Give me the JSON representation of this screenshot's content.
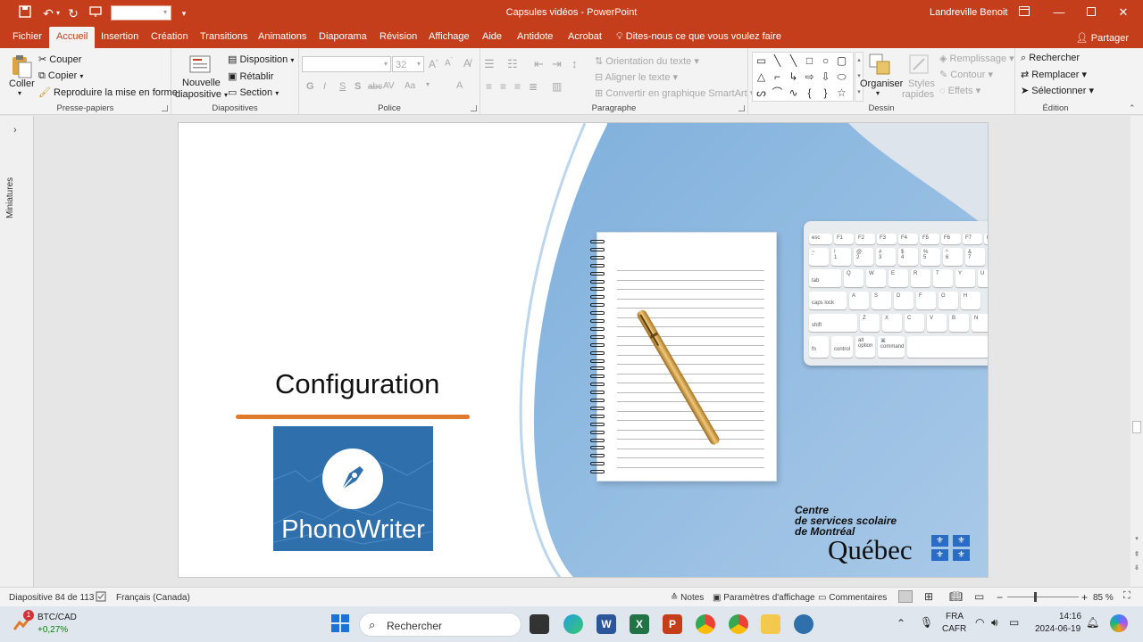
{
  "titlebar": {
    "document_title": "Capsules vidéos - PowerPoint",
    "user_name": "Landreville Benoit"
  },
  "tabs": [
    {
      "label": "Fichier",
      "active": false
    },
    {
      "label": "Accueil",
      "active": true
    },
    {
      "label": "Insertion",
      "active": false
    },
    {
      "label": "Création",
      "active": false
    },
    {
      "label": "Transitions",
      "active": false
    },
    {
      "label": "Animations",
      "active": false
    },
    {
      "label": "Diaporama",
      "active": false
    },
    {
      "label": "Révision",
      "active": false
    },
    {
      "label": "Affichage",
      "active": false
    },
    {
      "label": "Aide",
      "active": false
    },
    {
      "label": "Antidote",
      "active": false
    },
    {
      "label": "Acrobat",
      "active": false
    }
  ],
  "tell_me": "Dites-nous ce que vous voulez faire",
  "share_label": "Partager",
  "ribbon": {
    "clipboard": {
      "label": "Presse-papiers",
      "paste": "Coller",
      "cut": "Couper",
      "copy": "Copier",
      "format_painter": "Reproduire la mise en forme"
    },
    "slides": {
      "label": "Diapositives",
      "new_slide_1": "Nouvelle",
      "new_slide_2": "diapositive",
      "layout": "Disposition",
      "reset": "Rétablir",
      "section": "Section"
    },
    "font": {
      "label": "Police",
      "font_size": "32",
      "bold": "G",
      "italic": "I",
      "underline": "S",
      "shadow": "S",
      "strike": "abc",
      "spacing": "AV",
      "case": "Aa",
      "color": "A"
    },
    "paragraph": {
      "label": "Paragraphe",
      "text_direction": "Orientation du texte",
      "align_text": "Aligner le texte",
      "smartart": "Convertir en graphique SmartArt"
    },
    "drawing": {
      "label": "Dessin",
      "arrange": "Organiser",
      "styles_1": "Styles",
      "styles_2": "rapides",
      "fill": "Remplissage",
      "outline": "Contour",
      "effects": "Effets"
    },
    "editing": {
      "label": "Édition",
      "find": "Rechercher",
      "replace": "Remplacer",
      "select": "Sélectionner"
    }
  },
  "side_panel": {
    "label": "Miniatures"
  },
  "slide": {
    "title": "Configuration",
    "logo_text": "PhonoWriter",
    "brand_line1": "Centre",
    "brand_line2": "de services scolaire",
    "brand_line3": "de Montréal",
    "quebec": "Québec",
    "accent_color": "#e07a2c",
    "logo_color": "#2f6fab",
    "background_blue": "#8fb7df"
  },
  "keyboard_keys": {
    "row1": [
      "esc",
      "F1",
      "F2",
      "F3",
      "F4",
      "F5",
      "F6",
      "F7",
      "F8"
    ],
    "row2": [
      "~",
      "!",
      "@",
      "#",
      "$",
      "%",
      "^",
      "&"
    ],
    "row2_low": [
      "`",
      "1",
      "2",
      "3",
      "4",
      "5",
      "6",
      "7"
    ],
    "row3": [
      "tab",
      "Q",
      "W",
      "E",
      "R",
      "T",
      "Y",
      "U"
    ],
    "row4": [
      "caps lock",
      "A",
      "S",
      "D",
      "F",
      "G",
      "H"
    ],
    "row5": [
      "shift",
      "Z",
      "X",
      "C",
      "V",
      "B",
      "N"
    ],
    "row6": [
      "fn",
      "control",
      "alt",
      "option",
      "command"
    ]
  },
  "statusbar": {
    "slide_info": "Diapositive 84 de 113",
    "language": "Français (Canada)",
    "notes": "Notes",
    "display_settings": "Paramètres d'affichage",
    "comments": "Commentaires",
    "zoom_minus": "−",
    "zoom_plus": "+",
    "zoom": "85 %"
  },
  "taskbar": {
    "ticker": "BTC/CAD",
    "ticker_change": "+0,27%",
    "ticker_badge": "1",
    "search_placeholder": "Rechercher",
    "lang_1": "FRA",
    "lang_2": "CAFR",
    "time": "14:16",
    "date": "2024-06-19"
  }
}
